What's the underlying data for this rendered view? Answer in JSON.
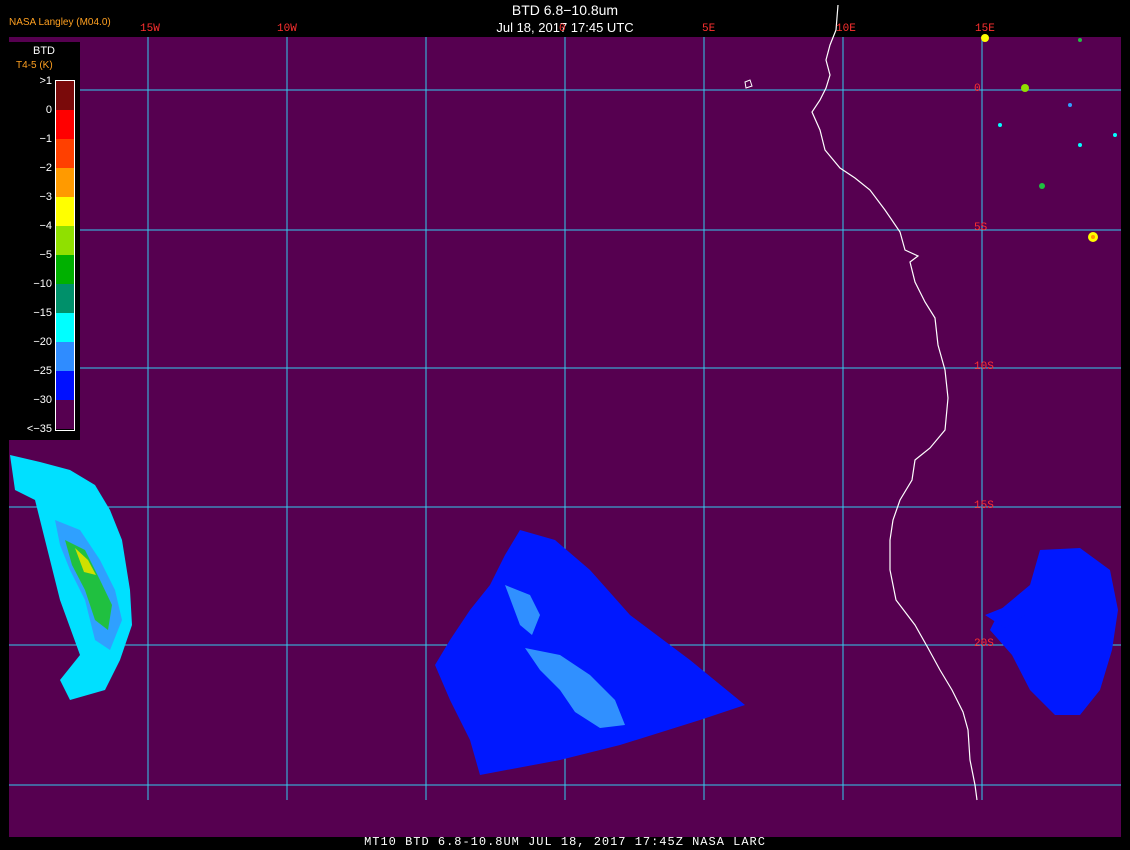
{
  "header": {
    "title": "BTD 6.8−10.8um",
    "subtitle": "Jul 18, 2017 17:45 UTC",
    "org": "NASA Langley (M04.0)"
  },
  "footer": {
    "text": "MT10  BTD 6.8-10.8UM   JUL 18, 2017 17:45Z   NASA LARC"
  },
  "map": {
    "background_color": "#560050",
    "grid_color": "#33ccee",
    "coast_color": "#ffffff",
    "longitude_labels": [
      "15W",
      "10W",
      "0",
      "5E",
      "10E",
      "15E"
    ],
    "latitude_labels": [
      "0",
      "5S",
      "10S",
      "15S",
      "20S"
    ]
  },
  "legend": {
    "title": "BTD",
    "unit": "T4-5 (K)",
    "items": [
      {
        "label": ">1",
        "color": "#7a0a0a"
      },
      {
        "label": "0",
        "color": "#ff0000"
      },
      {
        "label": "−1",
        "color": "#ff4000"
      },
      {
        "label": "−2",
        "color": "#ff9a00"
      },
      {
        "label": "−3",
        "color": "#ffff00"
      },
      {
        "label": "−4",
        "color": "#90e000"
      },
      {
        "label": "−5",
        "color": "#00b000"
      },
      {
        "label": "−10",
        "color": "#00906a"
      },
      {
        "label": "−15",
        "color": "#00ffff"
      },
      {
        "label": "−20",
        "color": "#2f8cff"
      },
      {
        "label": "−25",
        "color": "#0010ff"
      },
      {
        "label": "−30",
        "color": "#560050"
      },
      {
        "label": "<−35",
        "color": ""
      }
    ]
  }
}
